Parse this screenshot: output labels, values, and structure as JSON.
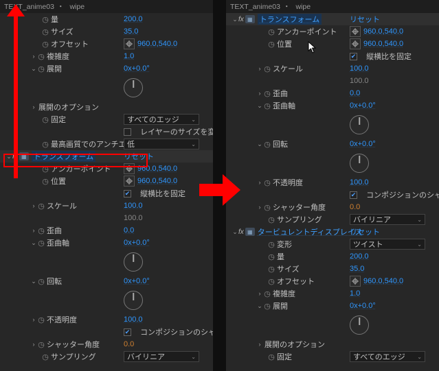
{
  "header": {
    "layer": "TEXT_anime03",
    "sep": "・",
    "tab": "wipe"
  },
  "glyph": {
    "twOpen": "⌄",
    "twClosed": "›",
    "stopwatch": "◷",
    "fx": "fx",
    "caret": "⌄"
  },
  "common": {
    "reset": "リセット",
    "transform": "トランスフォーム",
    "anchor": "アンカーポイント",
    "position": "位置",
    "lockAspect": "縦横比を固定",
    "scale": "スケール",
    "skew": "歪曲",
    "skewAxis": "歪曲軸",
    "rotation": "回転",
    "opacity": "不透明度",
    "useCompShutter": "コンポジションのシャッター…",
    "shutterAngle": "シャッター角度",
    "sampling": "サンプリング",
    "bilinear": "バイリニア",
    "zeroDeg": "0x+0.0°",
    "pt960": "960.0,540.0",
    "hundred": "100.0",
    "zero": "0.0"
  },
  "left": {
    "amount": "量",
    "amountVal": "200.0",
    "size": "サイズ",
    "sizeVal": "35.0",
    "offset": "オフセット",
    "complexity": "複雑度",
    "complexityVal": "1.0",
    "evolution": "展開",
    "evoOptions": "展開のオプション",
    "pin": "固定",
    "pinVal": "すべてのエッジ",
    "resizeLayer": "レイヤーのサイズを変更",
    "antialias": "最高画質でのアンチエイリ…",
    "antialiasVal": "低"
  },
  "right": {
    "turb": "タービュレントディスプレイス",
    "deform": "変形",
    "deformVal": "ツイスト",
    "amount": "量",
    "amountVal": "200.0",
    "size": "サイズ",
    "sizeVal": "35.0",
    "offset": "オフセット",
    "complexity": "複雑度",
    "complexityVal": "1.0",
    "evolution": "展開",
    "evoOptions": "展開のオプション",
    "pin": "固定",
    "pinVal": "すべてのエッジ"
  }
}
